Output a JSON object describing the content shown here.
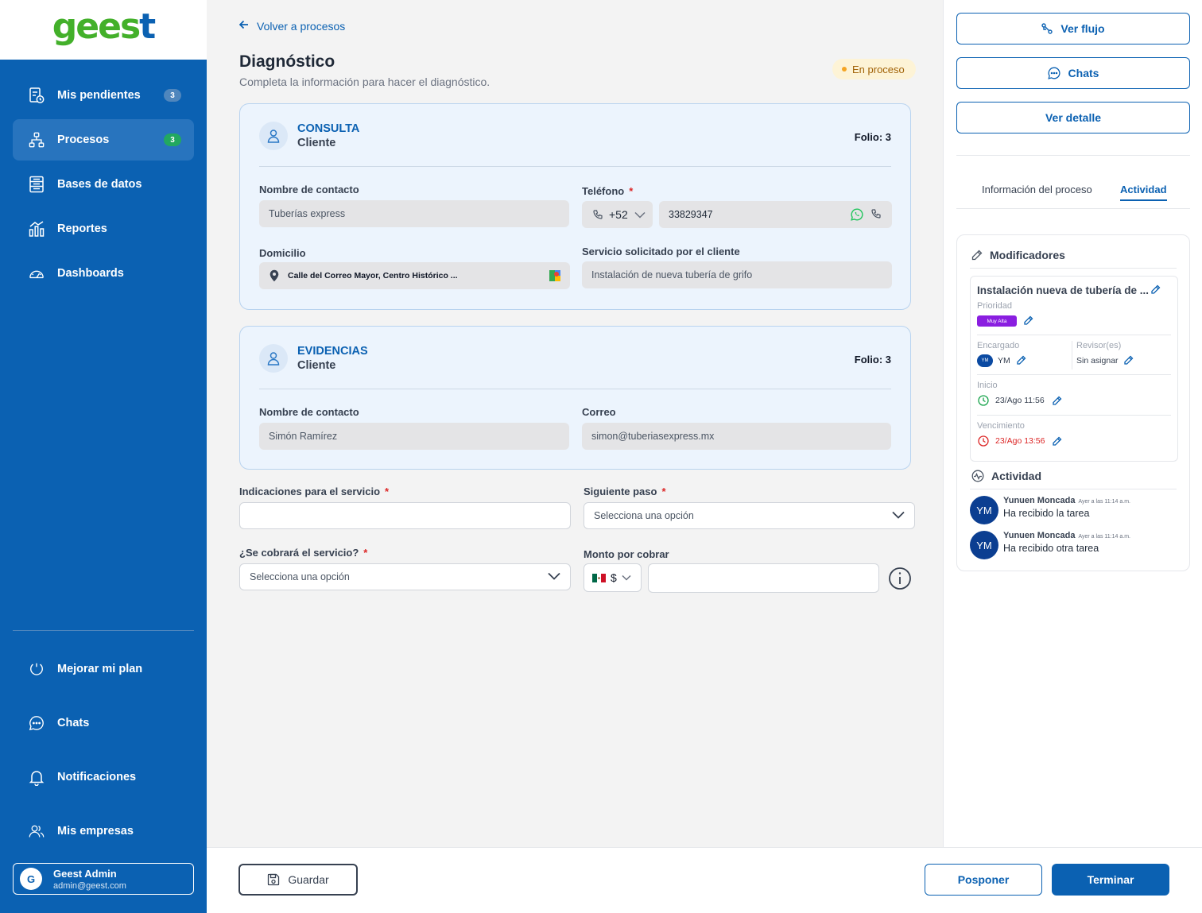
{
  "brand": {
    "logo_main": "gees",
    "logo_end": "t"
  },
  "sidebar": {
    "items": [
      {
        "label": "Mis pendientes",
        "badge": "3"
      },
      {
        "label": "Procesos",
        "badge": "3"
      },
      {
        "label": "Bases de datos"
      },
      {
        "label": "Reportes"
      },
      {
        "label": "Dashboards"
      }
    ],
    "bottom_items": [
      {
        "label": "Mejorar mi plan"
      },
      {
        "label": "Chats"
      },
      {
        "label": "Notificaciones"
      },
      {
        "label": "Mis empresas"
      }
    ],
    "user": {
      "initial": "G",
      "name": "Geest Admin",
      "email": "admin@geest.com"
    }
  },
  "main": {
    "back_label": "Volver a procesos",
    "title": "Diagnóstico",
    "subtitle": "Completa la información para hacer el diagnóstico.",
    "status": "En proceso",
    "consulta": {
      "title": "CONSULTA",
      "subtitle": "Cliente",
      "folio": "Folio: 3",
      "contact_label": "Nombre de contacto",
      "contact_value": "Tuberías express",
      "phone_label": "Teléfono",
      "phone_required": "*",
      "phone_code": "+52",
      "phone_value": "33829347",
      "address_label": "Domicilio",
      "address_value": "Calle del Correo Mayor, Centro Histórico ...",
      "service_label": "Servicio solicitado por el cliente",
      "service_value": "Instalación de nueva tubería de grifo"
    },
    "evidencias": {
      "title": "EVIDENCIAS",
      "subtitle": "Cliente",
      "folio": "Folio: 3",
      "contact_label": "Nombre de contacto",
      "contact_value": "Simón Ramírez",
      "email_label": "Correo",
      "email_value": "simon@tuberiasexpress.mx"
    },
    "form": {
      "indications_label": "Indicaciones para el servicio",
      "indications_value": "",
      "next_step_label": "Siguiente paso",
      "next_step_placeholder": "Selecciona una opción",
      "charge_label": "¿Se cobrará el servicio?",
      "charge_placeholder": "Selecciona una opción",
      "amount_label": "Monto por cobrar",
      "currency_symbol": "$",
      "amount_value": "",
      "required_mark": "*"
    }
  },
  "right_panel": {
    "buttons": {
      "flow": "Ver flujo",
      "chats": "Chats",
      "detail": "Ver detalle"
    },
    "tabs": [
      {
        "label": "Información del proceso"
      },
      {
        "label": "Actividad",
        "active": true
      }
    ],
    "modifiers": {
      "heading": "Modificadores",
      "task_title": "Instalación nueva de tubería de ...",
      "priority_label": "Prioridad",
      "priority_value": "Muy Alta",
      "assignee_label": "Encargado",
      "assignee_initials": "YM",
      "assignee_value": "YM",
      "reviewer_label": "Revisor(es)",
      "reviewer_value": "Sin asignar",
      "start_label": "Inicio",
      "start_value": "23/Ago 11:56",
      "due_label": "Vencimiento",
      "due_value": "23/Ago 13:56"
    },
    "activity": {
      "heading": "Actividad",
      "items": [
        {
          "initials": "YM",
          "name": "Yunuen Moncada",
          "time": "Ayer a las 11:14 a.m.",
          "message": "Ha recibido la tarea"
        },
        {
          "initials": "YM",
          "name": "Yunuen Moncada",
          "time": "Ayer a las 11:14 a.m.",
          "message": "Ha recibido otra tarea"
        }
      ]
    }
  },
  "footer": {
    "save": "Guardar",
    "postpone": "Posponer",
    "finish": "Terminar"
  },
  "colors": {
    "primary": "#0b61b2",
    "brand_green": "#43b02a",
    "danger": "#dc2626",
    "warning_bg": "#fdf3d6",
    "priority": "#8a1ee0"
  }
}
